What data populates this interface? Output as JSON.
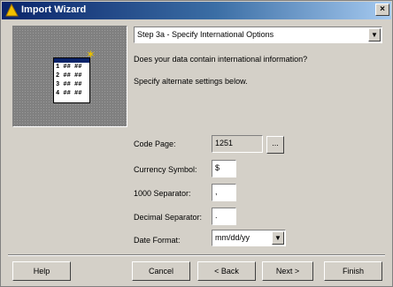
{
  "window": {
    "title": "Import Wizard",
    "close_glyph": "×"
  },
  "step": {
    "selected": "Step 3a - Specify International Options"
  },
  "question": "Does your data contain international information?",
  "instruction": "Specify alternate settings below.",
  "fields": [
    {
      "label": "Code Page:",
      "value": "1251"
    },
    {
      "label": "Currency Symbol:",
      "value": "$"
    },
    {
      "label": "1000 Separator:",
      "value": ","
    },
    {
      "label": "Decimal Separator:",
      "value": "."
    },
    {
      "label": "Date Format:",
      "value": "mm/dd/yy"
    }
  ],
  "preview": {
    "rows": [
      "1 ## ##",
      "2 ## ##",
      "3 ## ##",
      "4 ## ##"
    ]
  },
  "buttons": {
    "help": "Help",
    "cancel": "Cancel",
    "back": "< Back",
    "next": "Next >",
    "finish": "Finish",
    "browse": "..."
  },
  "icons": {
    "app": "wizard-app-icon",
    "dropdown": "chevron-down-icon",
    "sparkle": "sparkle-icon"
  }
}
